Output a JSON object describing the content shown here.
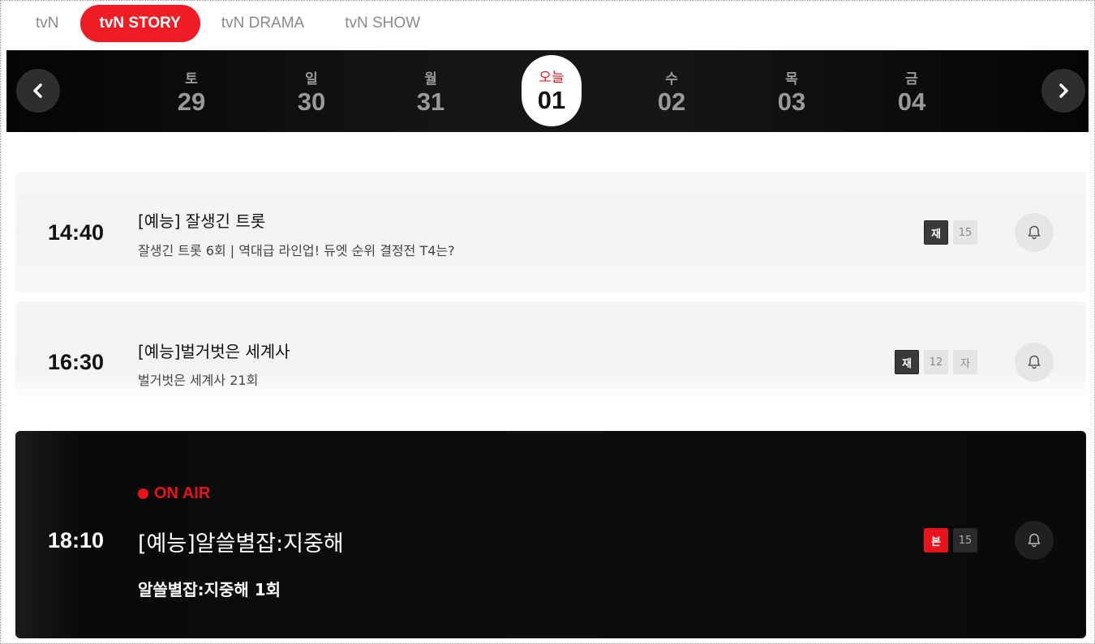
{
  "channel_tabs": [
    {
      "label": "tvN",
      "active": false
    },
    {
      "label": "tvN STORY",
      "active": true
    },
    {
      "label": "tvN DRAMA",
      "active": false
    },
    {
      "label": "tvN SHOW",
      "active": false
    }
  ],
  "date_nav": {
    "prev_icon": "chevron-left-icon",
    "next_icon": "chevron-right-icon",
    "days": [
      {
        "dow": "토",
        "date": "29"
      },
      {
        "dow": "일",
        "date": "30"
      },
      {
        "dow": "월",
        "date": "31"
      },
      {
        "dow": "오늘",
        "date": "01",
        "selected": true
      },
      {
        "dow": "수",
        "date": "02"
      },
      {
        "dow": "목",
        "date": "03"
      },
      {
        "dow": "금",
        "date": "04"
      }
    ]
  },
  "schedule": [
    {
      "time": "14:40",
      "title": "[예능] 잘생긴 트롯",
      "subtitle": "잘생긴 트롯 6회 | 역대급 라인업! 듀엣 순위 결정전 T4는?",
      "badges": [
        "재",
        "15"
      ],
      "bell_icon": "bell-icon"
    },
    {
      "time": "16:30",
      "title": "[예능]벌거벗은 세계사",
      "subtitle": "벌거벗은 세계사 21회",
      "badges": [
        "재",
        "12",
        "자"
      ],
      "bell_icon": "bell-icon"
    },
    {
      "time": "18:10",
      "on_air": "ON AIR",
      "title": "[예능]알쓸별잡:지중해",
      "subtitle": "알쓸별잡:지중해 1회",
      "badges": [
        "본",
        "15"
      ],
      "bell_icon": "bell-icon"
    }
  ],
  "colors": {
    "accent_red": "#e8141c",
    "tab_active": "#ee1c25",
    "dark_bg": "#0d0d0f"
  }
}
